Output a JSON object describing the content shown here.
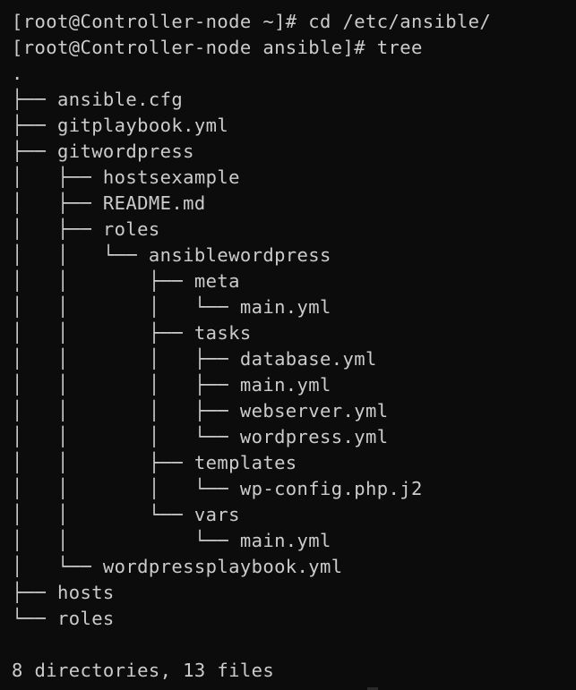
{
  "terminal": {
    "lines": [
      "[root@Controller-node ~]# cd /etc/ansible/",
      "[root@Controller-node ansible]# tree",
      ".",
      "├── ansible.cfg",
      "├── gitplaybook.yml",
      "├── gitwordpress",
      "│   ├── hostsexample",
      "│   ├── README.md",
      "│   ├── roles",
      "│   │   └── ansiblewordpress",
      "│   │       ├── meta",
      "│   │       │   └── main.yml",
      "│   │       ├── tasks",
      "│   │       │   ├── database.yml",
      "│   │       │   ├── main.yml",
      "│   │       │   ├── webserver.yml",
      "│   │       │   └── wordpress.yml",
      "│   │       ├── templates",
      "│   │       │   └── wp-config.php.j2",
      "│   │       └── vars",
      "│   │           └── main.yml",
      "│   └── wordpressplaybook.yml",
      "├── hosts",
      "└── roles",
      "",
      "8 directories, 13 files"
    ]
  }
}
